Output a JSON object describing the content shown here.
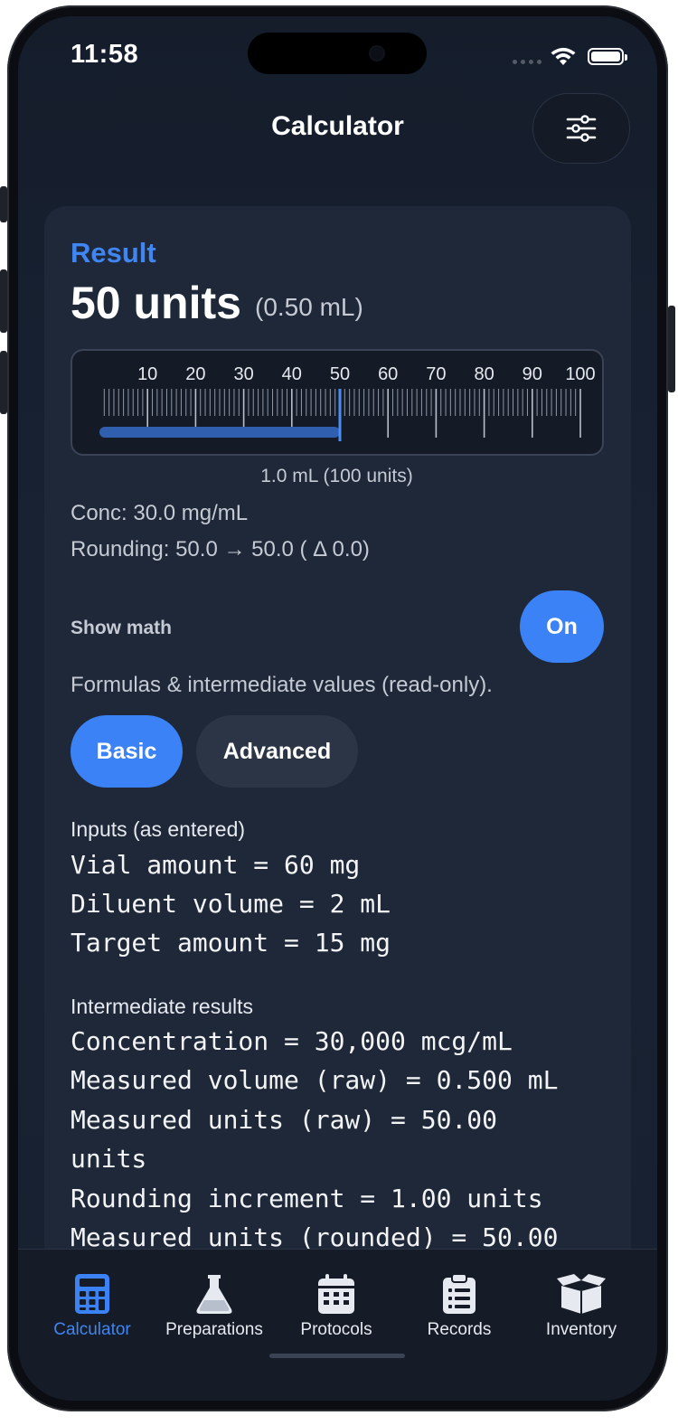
{
  "status": {
    "time": "11:58"
  },
  "header": {
    "title": "Calculator"
  },
  "result": {
    "label": "Result",
    "value": "50 units",
    "volume": "(0.50 mL)",
    "syringe": {
      "ticks": [
        "10",
        "20",
        "30",
        "40",
        "50",
        "60",
        "70",
        "80",
        "90",
        "100"
      ],
      "fill_units": 50,
      "max_units": 100,
      "caption": "1.0 mL (100 units)"
    },
    "concentration": "Conc: 30.0 mg/mL",
    "rounding": "Rounding: 50.0 → 50.0  ( Δ 0.0)"
  },
  "math": {
    "label": "Show math",
    "toggle": "On",
    "description": "Formulas & intermediate values (read-only).",
    "modes": {
      "basic": "Basic",
      "advanced": "Advanced"
    },
    "inputs_heading": "Inputs (as entered)",
    "inputs": [
      "Vial amount = 60 mg",
      "Diluent volume = 2 mL",
      "Target amount = 15 mg"
    ],
    "intermediate_heading": "Intermediate results",
    "intermediate": [
      "Concentration = 30,000 mcg/mL",
      "Measured volume (raw) = 0.500 mL",
      "Measured units (raw) = 50.00",
      "units",
      "Rounding increment = 1.00 units",
      "Measured units (rounded) = 50.00"
    ]
  },
  "tabs": [
    {
      "label": "Calculator"
    },
    {
      "label": "Preparations"
    },
    {
      "label": "Protocols"
    },
    {
      "label": "Records"
    },
    {
      "label": "Inventory"
    }
  ],
  "colors": {
    "accent": "#3b82f6",
    "background": "#182233",
    "card": "#1f2838"
  }
}
